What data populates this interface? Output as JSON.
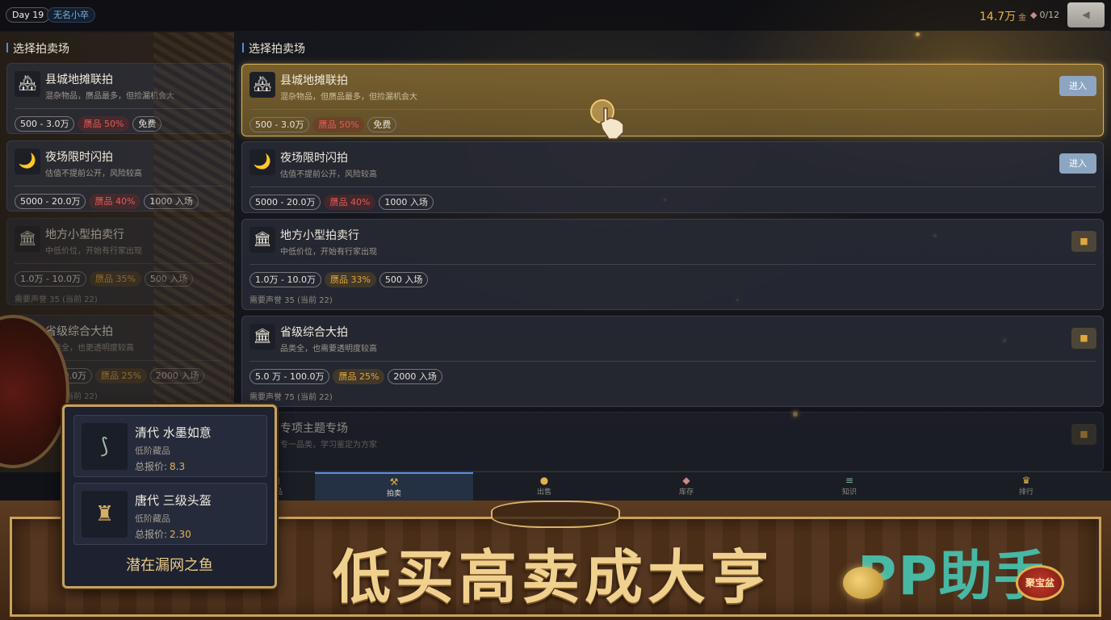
{
  "topbar": {
    "day": "Day 19",
    "player_name": "无名小卒",
    "gold": "14.7万",
    "gold_unit": "金",
    "capacity": "0/12",
    "speaker_icon": "speaker-icon"
  },
  "left_panel": {
    "title": "选择拍卖场",
    "venues": [
      {
        "name": "县城地摊联拍",
        "desc": "混杂物品，赝品最多，但捡漏机会大",
        "tags": [
          "500 - 3.0万",
          "赝品 50%",
          "免费"
        ]
      },
      {
        "name": "夜场限时闪拍",
        "desc": "估值不提前公开，风险较高",
        "tags": [
          "5000 - 20.0万",
          "赝品 40%",
          "1000 入场"
        ]
      },
      {
        "name": "地方小型拍卖行",
        "desc": "中低价位，开始有行家出现",
        "tags": [
          "1.0万 - 10.0万",
          "赝品 35%",
          "500 入场"
        ],
        "req": "需要声誉 35 (当前 22)"
      },
      {
        "name": "省级综合大拍",
        "desc": "品类全，也更透明度较高",
        "tags": [
          "5.0万 - 100.0万",
          "赝品 25%",
          "2000 入场"
        ],
        "req": "需要声誉 75 (当前 22)"
      }
    ]
  },
  "right_panel": {
    "title": "选择拍卖场",
    "enter_label": "进入",
    "venues": [
      {
        "name": "县城地摊联拍",
        "desc": "混杂物品，但赝品最多，但捡漏机会大",
        "tags": [
          "500 - 3.0万",
          "赝品 50%",
          "免费"
        ],
        "state": "enter"
      },
      {
        "name": "夜场限时闪拍",
        "desc": "估值不提前公开，风险较高",
        "tags": [
          "5000 - 20.0万",
          "赝品 40%",
          "1000 入场"
        ],
        "state": "enter"
      },
      {
        "name": "地方小型拍卖行",
        "desc": "中低价位，开始有行家出现",
        "tags": [
          "1.0万 - 10.0万",
          "赝品 33%",
          "500 入场"
        ],
        "req": "需要声誉 35 (当前 22)",
        "state": "locked"
      },
      {
        "name": "省级综合大拍",
        "desc": "品类全，也需要透明度较高",
        "tags": [
          "5.0 万 - 100.0万",
          "赝品 25%",
          "2000 入场"
        ],
        "req": "需要声誉 75 (当前 22)",
        "state": "locked"
      },
      {
        "name": "专项主题专场",
        "desc": "专一品类，学习鉴定为方家",
        "state": "locked"
      }
    ]
  },
  "tabs": [
    {
      "label": "藏品",
      "icon": "scroll-icon"
    },
    {
      "label": "拍卖",
      "icon": "hammer-icon"
    },
    {
      "label": "出售",
      "icon": "money-bag-icon"
    },
    {
      "label": "库存",
      "icon": "box-icon"
    },
    {
      "label": "知识",
      "icon": "books-icon"
    },
    {
      "label": "排行",
      "icon": "trophy-icon"
    }
  ],
  "popup": {
    "items": [
      {
        "name": "清代 水墨如意",
        "grade": "低阶藏品",
        "price_label": "总报价:",
        "price": "8.3"
      },
      {
        "name": "唐代 三级头盔",
        "grade": "低阶藏品",
        "price_label": "总报价:",
        "price": "2.30"
      }
    ],
    "footer": "潜在漏网之鱼"
  },
  "banner": {
    "slogan": "低买高卖成大亨",
    "watermark": "PP助手",
    "seal_text": "聚宝盆"
  },
  "colors": {
    "accent_blue": "#4f8ddb",
    "gold": "#e8b54a",
    "fake_red": "#e45c54",
    "fake_amber": "#e2a63f",
    "active_card": "#d9b45a"
  }
}
